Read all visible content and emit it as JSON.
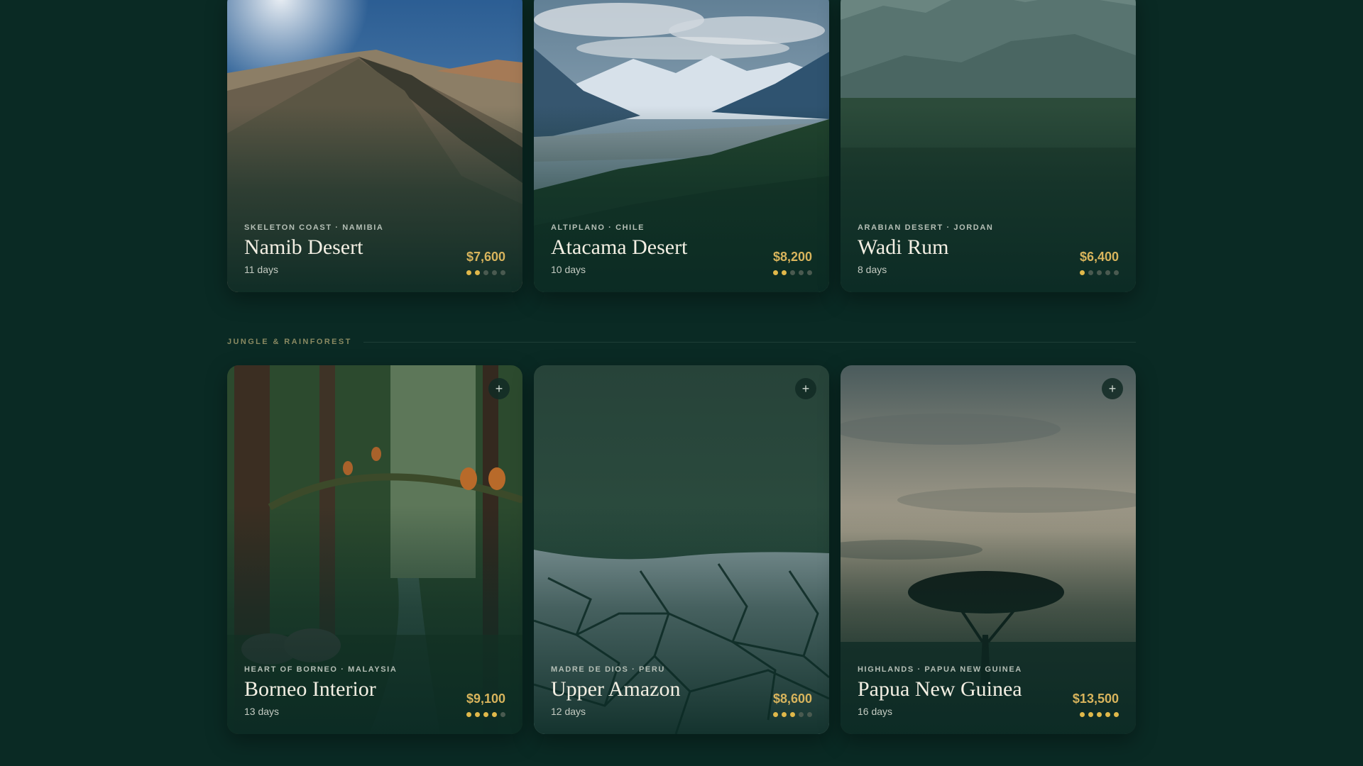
{
  "colors": {
    "background": "#0a2a24",
    "price": "#d8b45c",
    "dot_on": "#e0b84a",
    "dot_off": "#4a5a50"
  },
  "top_row": [
    {
      "region": "SKELETON COAST · NAMIBIA",
      "name": "Namib Desert",
      "days": "11 days",
      "price": "$7,600",
      "rating": 2,
      "rating_max": 5
    },
    {
      "region": "ALTIPLANO · CHILE",
      "name": "Atacama Desert",
      "days": "10 days",
      "price": "$8,200",
      "rating": 2,
      "rating_max": 5
    },
    {
      "region": "ARABIAN DESERT · JORDAN",
      "name": "Wadi Rum",
      "days": "8 days",
      "price": "$6,400",
      "rating": 1,
      "rating_max": 5
    }
  ],
  "section": {
    "label": "JUNGLE & RAINFOREST"
  },
  "bottom_row": [
    {
      "region": "HEART OF BORNEO · MALAYSIA",
      "name": "Borneo Interior",
      "days": "13 days",
      "price": "$9,100",
      "rating": 4,
      "rating_max": 5,
      "action_icon": "+"
    },
    {
      "region": "MADRE DE DIOS · PERU",
      "name": "Upper Amazon",
      "days": "12 days",
      "price": "$8,600",
      "rating": 3,
      "rating_max": 5,
      "action_icon": "+"
    },
    {
      "region": "HIGHLANDS · PAPUA NEW GUINEA",
      "name": "Papua New Guinea",
      "days": "16 days",
      "price": "$13,500",
      "rating": 5,
      "rating_max": 5,
      "action_icon": "+"
    }
  ]
}
